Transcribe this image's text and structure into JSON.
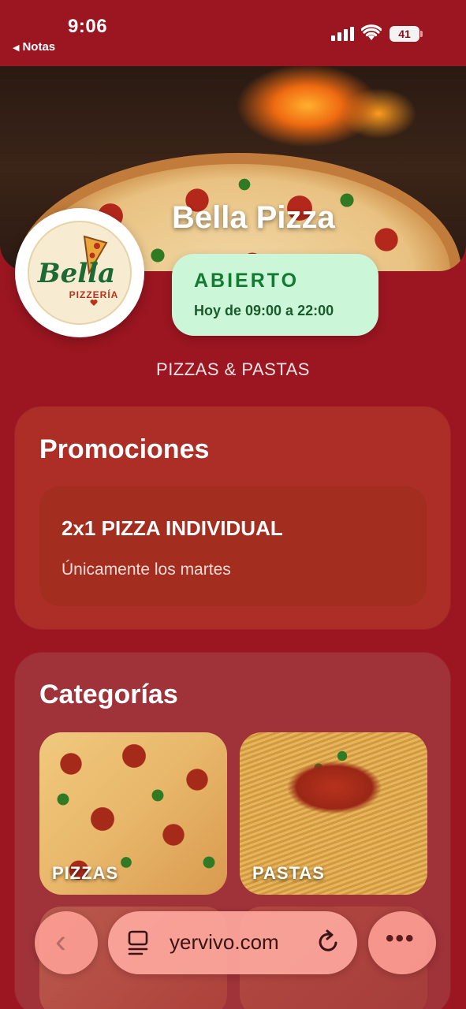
{
  "status_bar": {
    "time": "9:06",
    "back_app": "Notas",
    "battery": "41"
  },
  "hero": {
    "title": "Bella Pizza"
  },
  "logo": {
    "name": "Bella",
    "subtitle": "PIZZERÍA"
  },
  "badge": {
    "status": "ABIERTO",
    "hours": "Hoy de 09:00 a 22:00"
  },
  "tagline": "PIZZAS & PASTAS",
  "promotions": {
    "title": "Promociones",
    "items": [
      {
        "title": "2x1 PIZZA INDIVIDUAL",
        "description": "Únicamente los martes"
      }
    ]
  },
  "categories": {
    "title": "Categorías",
    "items": [
      {
        "label": "PIZZAS"
      },
      {
        "label": "PASTAS"
      }
    ]
  },
  "browser": {
    "url": "yervivo.com",
    "icons": [
      "chevron-left-icon",
      "tabs-icon",
      "reload-icon",
      "more-icon"
    ]
  },
  "colors": {
    "background": "#9b1620",
    "card": "#ac2e26",
    "badge_bg": "#ccf6d8",
    "badge_text": "#137a32"
  }
}
